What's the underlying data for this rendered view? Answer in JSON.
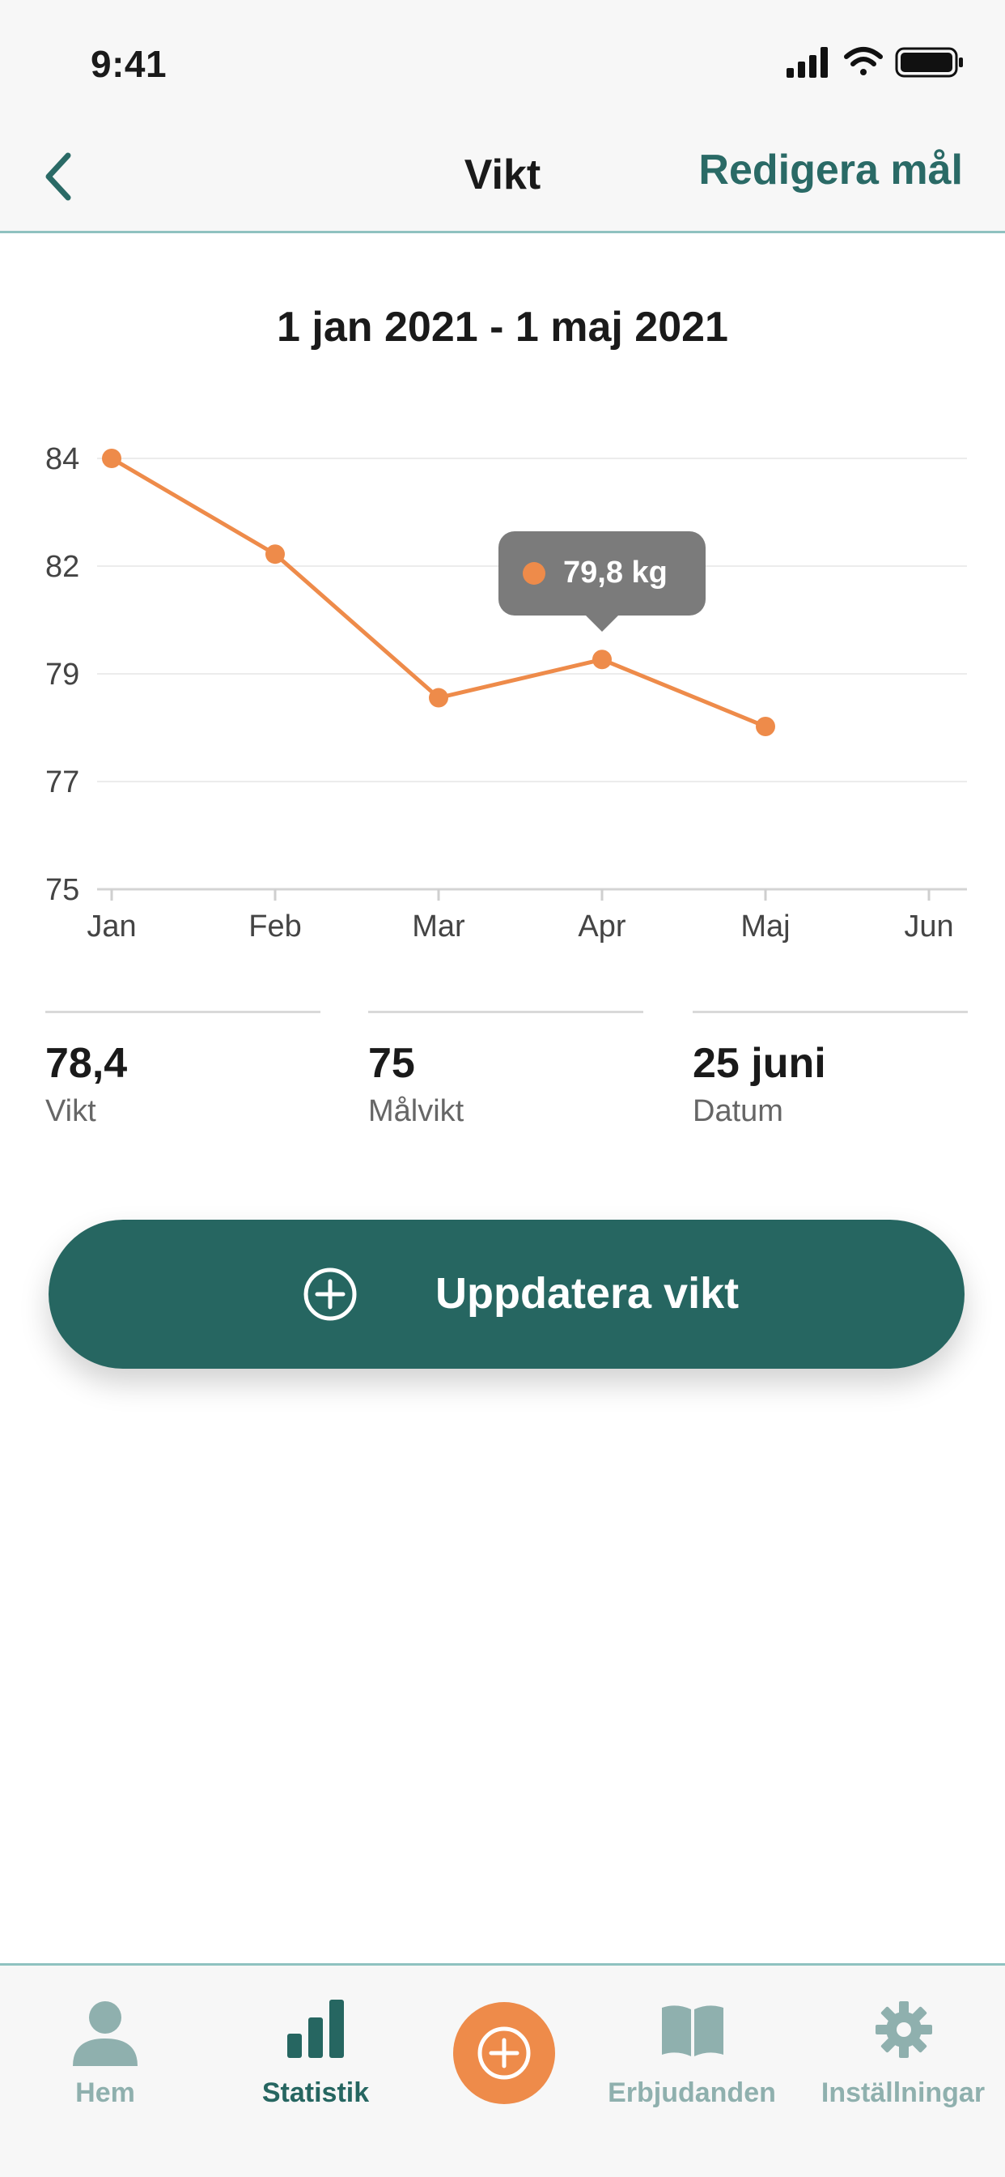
{
  "status_bar": {
    "time": "9:41"
  },
  "header": {
    "title": "Vikt",
    "edit_goal": "Redigera mål"
  },
  "date_range": "1 jan 2021 - 1 maj 2021",
  "chart_data": {
    "type": "line",
    "x": [
      "Jan",
      "Feb",
      "Mar",
      "Apr",
      "Maj"
    ],
    "x_ticks": [
      "Jan",
      "Feb",
      "Mar",
      "Apr",
      "Maj",
      "Jun"
    ],
    "y_ticks": [
      "84",
      "82",
      "79",
      "77",
      "75"
    ],
    "series": [
      {
        "values": [
          84,
          82,
          79,
          79.8,
          78.4
        ]
      }
    ],
    "ylim": [
      75,
      84
    ],
    "grid": true,
    "color": "#ee8b4a",
    "tooltip": {
      "x": "Apr",
      "text": "79,8 kg"
    }
  },
  "stats": [
    {
      "value": "78,4",
      "label": "Vikt"
    },
    {
      "value": "75",
      "label": "Målvikt"
    },
    {
      "value": "25 juni",
      "label": "Datum"
    }
  ],
  "update_button": {
    "label": "Uppdatera vikt"
  },
  "tabs": [
    {
      "label": "Hem",
      "icon": "person-icon"
    },
    {
      "label": "Statistik",
      "icon": "bar-chart-icon",
      "active": true
    },
    {
      "label": "",
      "icon": "add-circle-icon"
    },
    {
      "label": "Erbjudanden",
      "icon": "book-icon"
    },
    {
      "label": "Inställningar",
      "icon": "gear-icon"
    }
  ],
  "colors": {
    "accent": "#266661",
    "orange": "#ee8b4a",
    "divider": "#8fc2c0"
  }
}
